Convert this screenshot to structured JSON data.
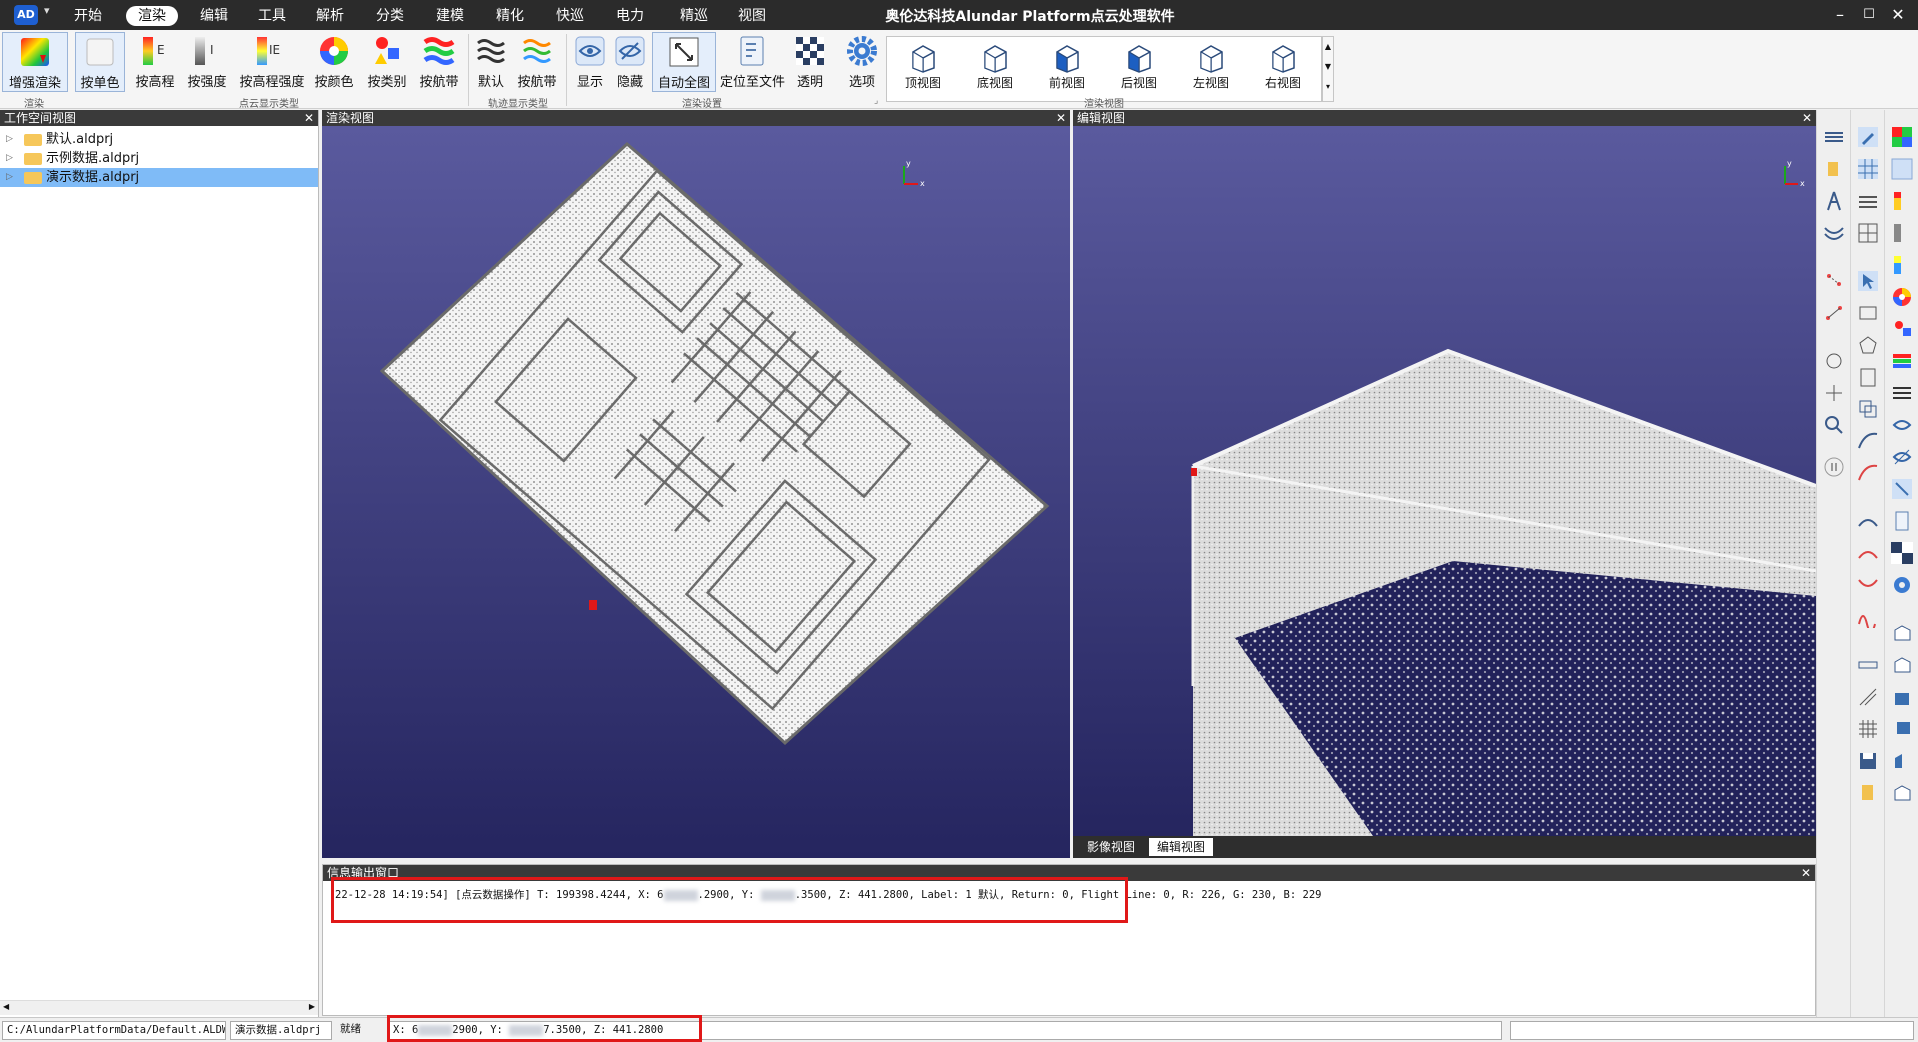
{
  "app": {
    "icon_text": "AD",
    "title": "奥伦达科技Alundar Platform点云处理软件"
  },
  "menu": {
    "items": [
      "开始",
      "渲染",
      "编辑",
      "工具",
      "解析",
      "分类",
      "建模",
      "精化",
      "快巡",
      "电力",
      "精巡",
      "视图"
    ],
    "active": "渲染"
  },
  "ribbon": {
    "buttons": [
      "增强渲染",
      "按单色",
      "按高程",
      "按强度",
      "按高程强度",
      "按颜色",
      "按类别",
      "按航带",
      "默认",
      "按航带",
      "显示",
      "隐藏",
      "自动全图",
      "定位至文件",
      "透明",
      "选项"
    ],
    "groups": [
      "渲染",
      "点云显示类型",
      "轨迹显示类型",
      "渲染设置",
      "渲染视图"
    ],
    "views": [
      "顶视图",
      "底视图",
      "前视图",
      "后视图",
      "左视图",
      "右视图"
    ]
  },
  "workspace": {
    "title": "工作空间视图",
    "items": [
      "默认.aldprj",
      "示例数据.aldprj",
      "演示数据.aldprj"
    ],
    "selected_index": 2
  },
  "render_view": {
    "title": "渲染视图"
  },
  "edit_view": {
    "title": "编辑视图"
  },
  "bottom_tabs": {
    "items": [
      "影像视图",
      "编辑视图"
    ],
    "active": "编辑视图"
  },
  "output": {
    "title": "信息输出窗口",
    "log": {
      "prefix": "22-12-28 14:19:54] [点云数据操作] T: 199398.4244, X: 6",
      "x_tail": ".2900, Y: ",
      "y_tail": ".3500, Z: 441.2800, Label: 1 默认, Return: 0, Flight Line: 0, R: 226, G: 230, B: 229"
    }
  },
  "status": {
    "path": "C:/AlundarPlatformData/Default.ALDWS",
    "project": "演示数据.aldprj",
    "state": "就绪",
    "coords": {
      "x_prefix": "X: 6",
      "x_tail": "2900,  Y: ",
      "y_tail": "7.3500,  Z: 441.2800"
    }
  },
  "axis_labels": {
    "x": "x",
    "y": "y"
  },
  "colors": {
    "titlebar": "#2b2b2b",
    "viewport_top": "#5a5a9e",
    "viewport_bottom": "#25255f",
    "selection": "#7fbbf7",
    "highlight_box": "#e01818"
  }
}
